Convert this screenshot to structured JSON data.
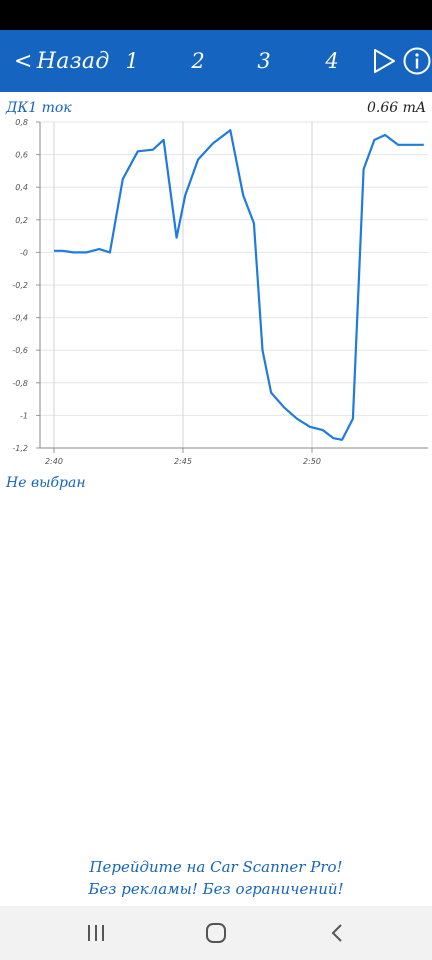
{
  "toolbar": {
    "back_label": "Назад",
    "tabs": [
      "1",
      "2",
      "3",
      "4"
    ]
  },
  "sensor": {
    "name": "ДК1 ток",
    "value": "0.66 mA"
  },
  "chart_data": {
    "type": "line",
    "x_tick_labels": [
      "2:40",
      "2:45",
      "2:50"
    ],
    "y_tick_labels": [
      "0,8",
      "0,6",
      "0,4",
      "0,2",
      "-0",
      "-0,2",
      "-0,4",
      "-0,6",
      "-0,8",
      "-1",
      "-1,2"
    ],
    "ylim": [
      -1.2,
      0.8
    ],
    "xlim_seconds": [
      0,
      860
    ],
    "grid": true,
    "series": [
      {
        "color": "#1e7be0",
        "x_seconds": [
          0,
          20,
          45,
          75,
          105,
          130,
          160,
          195,
          230,
          255,
          285,
          305,
          335,
          370,
          410,
          440,
          465,
          485,
          505,
          535,
          565,
          595,
          625,
          650,
          670,
          695,
          720,
          745,
          770,
          800,
          825,
          860
        ],
        "y": [
          0.01,
          0.01,
          0.0,
          0.0,
          0.02,
          0.0,
          0.45,
          0.62,
          0.63,
          0.69,
          0.09,
          0.35,
          0.57,
          0.67,
          0.75,
          0.35,
          0.18,
          -0.6,
          -0.86,
          -0.95,
          -1.02,
          -1.07,
          -1.09,
          -1.14,
          -1.15,
          -1.02,
          0.51,
          0.69,
          0.72,
          0.66,
          0.66,
          0.66
        ]
      }
    ]
  },
  "selection_label": "Не выбран",
  "promo": {
    "line1": "Перейдите на Car Scanner Pro!",
    "line2": "Без рекламы! Без ограничений!"
  },
  "colors": {
    "toolbar": "#1565c0",
    "accent": "#1565c0",
    "line": "#1e7be0"
  }
}
